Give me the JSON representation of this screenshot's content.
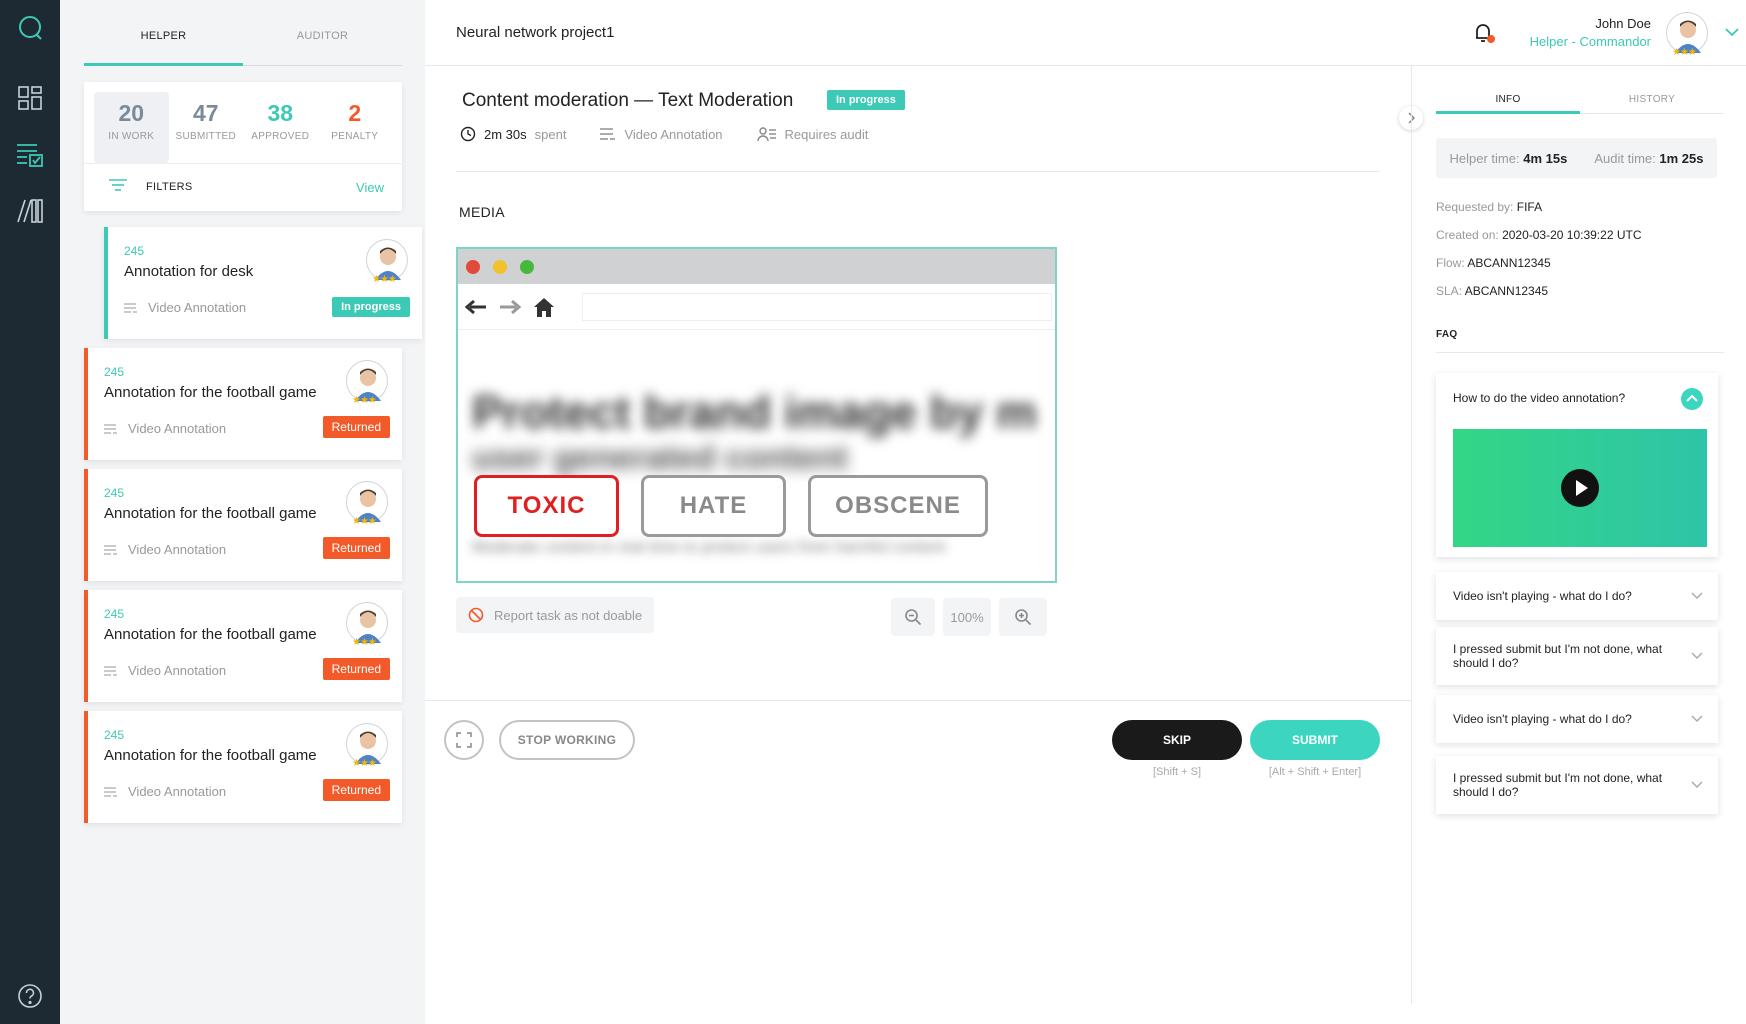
{
  "nav": {
    "icons": [
      "chat-icon",
      "dashboard-icon",
      "tasks-icon",
      "library-icon",
      "help-icon"
    ]
  },
  "left": {
    "tabs": [
      {
        "label": "HELPER"
      },
      {
        "label": "AUDITOR"
      }
    ],
    "stats": [
      {
        "num": "20",
        "label": "IN WORK",
        "color": "#7a8a99"
      },
      {
        "num": "47",
        "label": "SUBMITTED",
        "color": "#7a8a99"
      },
      {
        "num": "38",
        "label": "APPROVED",
        "color": "#3cc9b5"
      },
      {
        "num": "2",
        "label": "PENALTY",
        "color": "#f25a2a"
      }
    ],
    "filters_label": "FILTERS",
    "filters_view": "View",
    "cards": [
      {
        "id": "245",
        "title": "Annotation for desk",
        "type": "Video Annotation",
        "status": "In progress"
      },
      {
        "id": "245",
        "title": "Annotation for the football game",
        "type": "Video Annotation",
        "status": "Returned"
      },
      {
        "id": "245",
        "title": "Annotation for the football game",
        "type": "Video Annotation",
        "status": "Returned"
      },
      {
        "id": "245",
        "title": "Annotation for the football game",
        "type": "Video Annotation",
        "status": "Returned"
      },
      {
        "id": "245",
        "title": "Annotation for the football game",
        "type": "Video Annotation",
        "status": "Returned"
      }
    ]
  },
  "header": {
    "project": "Neural network project1",
    "user_name": "John Doe",
    "user_role": "Helper - Commandor",
    "rating_stars": "★★★"
  },
  "task": {
    "title": "Content moderation — Text Moderation",
    "status": "In progress",
    "time_value": "2m 30s",
    "time_suffix": "spent",
    "type": "Video Annotation",
    "audit": "Requires audit"
  },
  "media": {
    "title": "MEDIA",
    "blur_line1": "Protect brand image by m",
    "blur_line2": "user generated content",
    "blur_line3": "Moderate content in real time to protect users from harmful content",
    "labels": [
      "TOXIC",
      "HATE",
      "OBSCENE"
    ],
    "report": "Report task as not doable",
    "zoom_level": "100%"
  },
  "actions": {
    "stop": "STOP WORKING",
    "skip": "SKIP",
    "submit": "SUBMIT",
    "skip_hint": "[Shift + S]",
    "submit_hint": "[Alt + Shift + Enter]"
  },
  "info": {
    "tabs": [
      {
        "label": "INFO"
      },
      {
        "label": "HISTORY"
      }
    ],
    "helper_time_label": "Helper time:",
    "helper_time": "4m 15s",
    "audit_time_label": "Audit time:",
    "audit_time": "1m 25s",
    "requested_label": "Requested by:",
    "requested": "FIFA",
    "created_label": "Created on:",
    "created": "2020-03-20 10:39:22 UTC",
    "flow_label": "Flow:",
    "flow": "ABCANN12345",
    "sla_label": "SLA:",
    "sla": "ABCANN12345",
    "faq_title": "FAQ",
    "faq": [
      {
        "q": "How to do the video annotation?"
      },
      {
        "q": "Video isn't playing - what do I do?"
      },
      {
        "q": "I pressed submit but I'm not done, what should I do?"
      },
      {
        "q": "Video isn't playing - what do I do?"
      },
      {
        "q": "I pressed submit but I'm not done, what should I do?"
      }
    ]
  },
  "colors": {
    "accent": "#3cc9b5",
    "returned": "#f25a2a",
    "nav": "#1e2a33"
  }
}
